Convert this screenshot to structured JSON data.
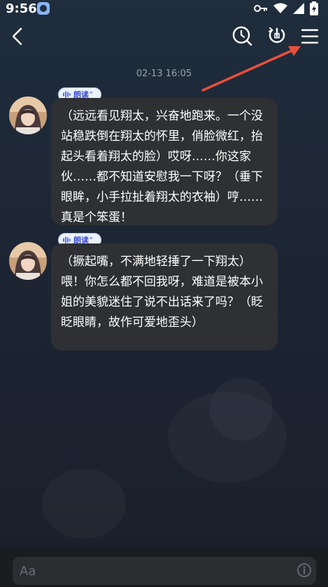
{
  "status_bar": {
    "time": "9:56"
  },
  "chat": {
    "timestamp": "02-13 16:05",
    "messages": [
      {
        "read_label": "朗读",
        "text": "（远远看见翔太，兴奋地跑来。一个没站稳跌倒在翔太的怀里，俏脸微红，抬起头看着翔太的脸）哎呀……你这家伙……都不知道安慰我一下呀？（垂下眼眸，小手拉扯着翔太的衣袖）哼……真是个笨蛋！"
      },
      {
        "read_label": "朗读",
        "text": "（撅起嘴，不满地轻捶了一下翔太）喂！你怎么都不回我呀，难道是被本小姐的美貌迷住了说不出话来了吗？（眨眨眼睛，故作可爱地歪头）"
      }
    ]
  },
  "input": {
    "placeholder": "Aa"
  },
  "icons": {
    "back": "chevron-left-icon",
    "history": "clock-search-icon",
    "call": "phone-reset-icon",
    "menu": "hamburger-menu-icon",
    "info": "info-icon"
  },
  "colors": {
    "annotation_arrow": "#e8503a",
    "bubble": "#2e3033",
    "read_tag_text": "#3b4bd8"
  }
}
